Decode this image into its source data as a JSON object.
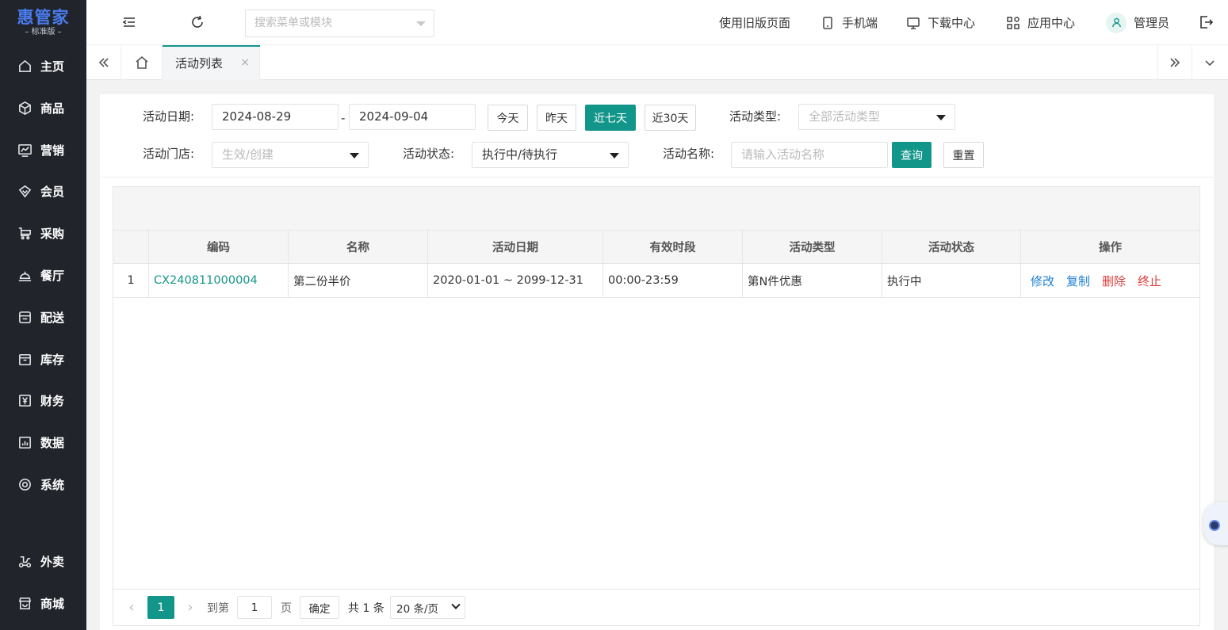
{
  "brand": {
    "name": "惠管家",
    "edition": "标准版",
    "accent": "#13968a",
    "logo_color": "#4a7cf0"
  },
  "sidebar": {
    "items": [
      {
        "label": "主页",
        "icon": "home-icon"
      },
      {
        "label": "商品",
        "icon": "cube-icon"
      },
      {
        "label": "营销",
        "icon": "chart-icon"
      },
      {
        "label": "会员",
        "icon": "diamond-icon"
      },
      {
        "label": "采购",
        "icon": "cart-icon"
      },
      {
        "label": "餐厅",
        "icon": "dish-icon"
      },
      {
        "label": "配送",
        "icon": "delivery-icon"
      },
      {
        "label": "库存",
        "icon": "box-icon"
      },
      {
        "label": "财务",
        "icon": "yen-icon"
      },
      {
        "label": "数据",
        "icon": "bar-chart-icon"
      },
      {
        "label": "系统",
        "icon": "target-icon"
      },
      {
        "label": "外卖",
        "icon": "scooter-icon"
      },
      {
        "label": "商城",
        "icon": "store-icon"
      }
    ]
  },
  "topbar": {
    "search_placeholder": "搜索菜单或模块",
    "old_page": "使用旧版页面",
    "mobile": "手机端",
    "download": "下载中心",
    "apps": "应用中心",
    "user": "管理员"
  },
  "tabs": {
    "active": "活动列表",
    "close": "×"
  },
  "filters": {
    "date_label": "活动日期:",
    "date_start": "2024-08-29",
    "date_sep": "-",
    "date_end": "2024-09-04",
    "quick": [
      "今天",
      "昨天",
      "近七天",
      "近30天"
    ],
    "type_label": "活动类型:",
    "type_placeholder": "全部活动类型",
    "store_label": "活动门店:",
    "store_placeholder": "生效/创建",
    "status_label": "活动状态:",
    "status_value": "执行中/待执行",
    "name_label": "活动名称:",
    "name_placeholder": "请输入活动名称",
    "query": "查询",
    "reset": "重置"
  },
  "table": {
    "headers": [
      "",
      "编码",
      "名称",
      "活动日期",
      "有效时段",
      "活动类型",
      "活动状态",
      "操作"
    ],
    "rows": [
      {
        "index": "1",
        "code": "CX240811000004",
        "name": "第二份半价",
        "date": "2020-01-01 ~ 2099-12-31",
        "period": "00:00-23:59",
        "type": "第N件优惠",
        "status": "执行中",
        "ops": [
          "修改",
          "复制",
          "删除",
          "终止"
        ]
      }
    ]
  },
  "pager": {
    "current": "1",
    "goto": "到第",
    "page_input": "1",
    "page_unit": "页",
    "confirm": "确定",
    "total": "共 1 条",
    "size": "20 条/页"
  }
}
